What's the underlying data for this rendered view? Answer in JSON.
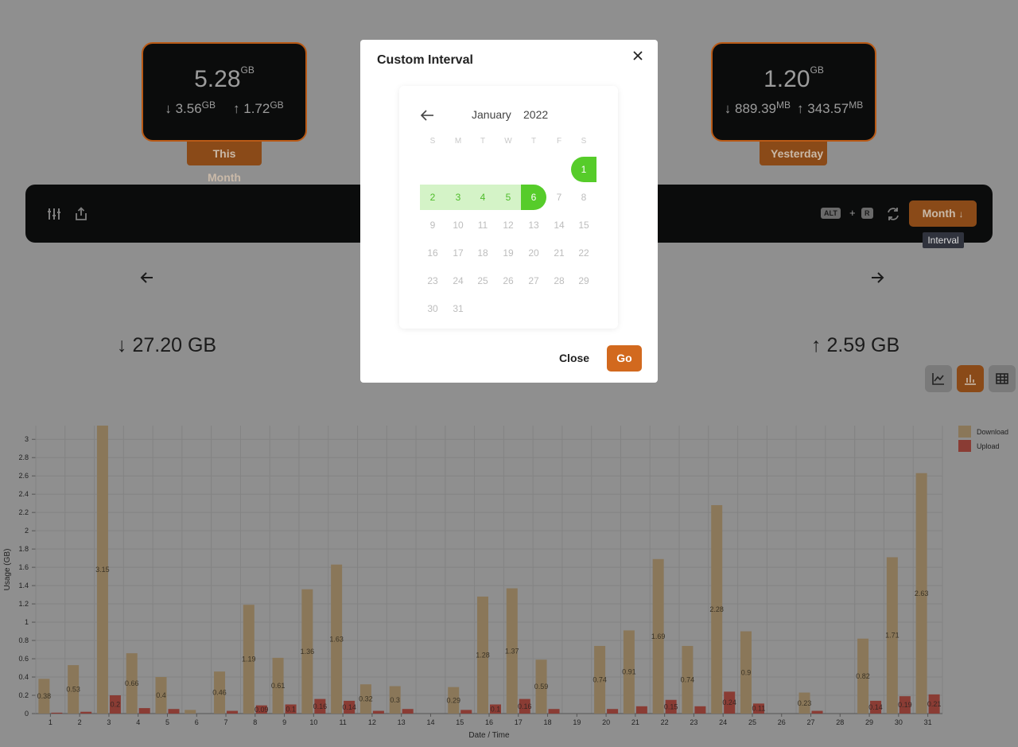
{
  "cards": {
    "this_month": {
      "total": "5.28",
      "total_unit": "GB",
      "down": "3.56",
      "down_unit": "GB",
      "up": "1.72",
      "up_unit": "GB",
      "label": "This Month"
    },
    "yesterday": {
      "total": "1.20",
      "total_unit": "GB",
      "down": "889.39",
      "down_unit": "MB",
      "up": "343.57",
      "up_unit": "MB",
      "label": "Yesterday"
    }
  },
  "toolbar": {
    "icons": [
      "sliders-icon",
      "share-icon",
      "refresh-icon"
    ],
    "shortcut_key1": "ALT",
    "shortcut_plus": "+",
    "shortcut_key2": "R",
    "interval_button": "Month",
    "tooltip": "Interval"
  },
  "totals": {
    "download": "27.20 GB",
    "upload": "2.59 GB"
  },
  "views": [
    "line-chart-icon",
    "bar-chart-icon",
    "table-icon"
  ],
  "colors": {
    "accent": "#8a4a18",
    "go": "#d2691e",
    "selected": "#56cc2a",
    "range": "#d4f3c7",
    "download": "#8a7759",
    "upload": "#8a3c34"
  },
  "modal": {
    "title": "Custom Interval",
    "month": "January",
    "year": "2022",
    "weekdays": [
      "S",
      "M",
      "T",
      "W",
      "T",
      "F",
      "S"
    ],
    "days": [
      "1",
      "2",
      "3",
      "4",
      "5",
      "6",
      "7",
      "8",
      "9",
      "10",
      "11",
      "12",
      "13",
      "14",
      "15",
      "16",
      "17",
      "18",
      "19",
      "20",
      "21",
      "22",
      "23",
      "24",
      "25",
      "26",
      "27",
      "28",
      "29",
      "30",
      "31"
    ],
    "range_start": 1,
    "range_end": 6,
    "close_label": "Close",
    "go_label": "Go"
  },
  "chart_data": {
    "type": "bar",
    "xlabel": "Date / Time",
    "ylabel": "Usage (GB)",
    "ylim": [
      0,
      3.15
    ],
    "yticks": [
      "0",
      "0.2",
      "0.4",
      "0.6",
      "0.8",
      "1",
      "1.2",
      "1.4",
      "1.6",
      "1.8",
      "2",
      "2.2",
      "2.4",
      "2.6",
      "2.8",
      "3"
    ],
    "legend_position": "top-right",
    "categories": [
      "1",
      "2",
      "3",
      "4",
      "5",
      "6",
      "7",
      "8",
      "9",
      "10",
      "11",
      "12",
      "13",
      "14",
      "15",
      "16",
      "17",
      "18",
      "19",
      "20",
      "21",
      "22",
      "23",
      "24",
      "25",
      "26",
      "27",
      "28",
      "29",
      "30",
      "31"
    ],
    "series": [
      {
        "name": "Download",
        "values": [
          0.38,
          0.53,
          3.15,
          0.66,
          0.4,
          0.04,
          0.46,
          1.19,
          0.61,
          1.36,
          1.63,
          0.32,
          0.3,
          0,
          0.29,
          1.28,
          1.37,
          0.59,
          0,
          0.74,
          0.91,
          1.69,
          0.74,
          2.28,
          0.9,
          0,
          0.23,
          0,
          0.82,
          1.71,
          2.63
        ]
      },
      {
        "name": "Upload",
        "values": [
          0.01,
          0.02,
          0.2,
          0.06,
          0.05,
          0,
          0.03,
          0.09,
          0.1,
          0.16,
          0.14,
          0.03,
          0.05,
          0,
          0.04,
          0.1,
          0.16,
          0.05,
          0,
          0.05,
          0.08,
          0.15,
          0.08,
          0.24,
          0.11,
          0,
          0.03,
          0,
          0.14,
          0.19,
          0.21
        ]
      }
    ],
    "download_labels": [
      "0.38",
      "0.53",
      "3.15",
      "0.66",
      "0.4",
      "",
      "0.46",
      "1.19",
      "0.61",
      "1.36",
      "1.63",
      "0.32",
      "0.3",
      "",
      "0.29",
      "1.28",
      "1.37",
      "0.59",
      "",
      "0.74",
      "0.91",
      "1.69",
      "0.74",
      "2.28",
      "0.9",
      "",
      "0.23",
      "",
      "0.82",
      "1.71",
      "2.63"
    ],
    "upload_labels": [
      "",
      "",
      "0.2",
      "",
      "",
      "",
      "",
      "0.09",
      "0.1",
      "0.16",
      "0.14",
      "",
      "",
      "",
      "",
      "0.1",
      "0.16",
      "",
      "",
      "",
      "",
      "0.15",
      "",
      "0.24",
      "0.11",
      "",
      "",
      "",
      "0.14",
      "0.19",
      "0.21"
    ]
  }
}
